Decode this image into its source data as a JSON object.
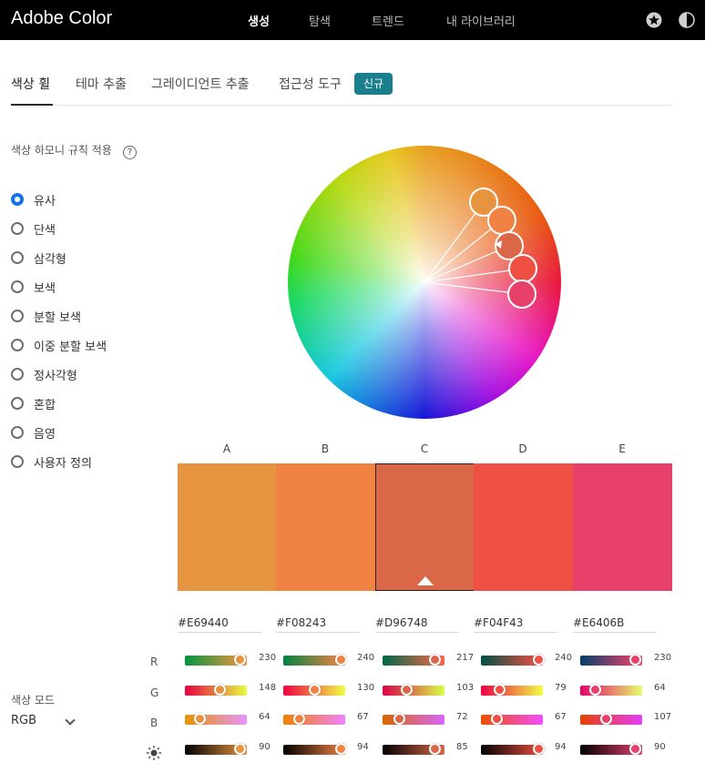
{
  "brand": "Adobe Color",
  "nav": [
    "생성",
    "탐색",
    "트렌드",
    "내 라이브러리"
  ],
  "tabs": [
    "색상 휠",
    "테마 추출",
    "그레이디언트 추출",
    "접근성 도구"
  ],
  "badge": "신규",
  "harmony": {
    "title": "색상 하모니 규칙 적용",
    "help": "?",
    "options": [
      "유사",
      "단색",
      "삼각형",
      "보색",
      "분할 보색",
      "이중 분할 보색",
      "정사각형",
      "혼합",
      "음영",
      "사용자 정의"
    ],
    "selected": "유사"
  },
  "columns": [
    "A",
    "B",
    "C",
    "D",
    "E"
  ],
  "selected_column": "C",
  "swatches": [
    {
      "hex": "#E69440",
      "color": "#E69440",
      "r": 230,
      "g": 148,
      "b": 64,
      "bright": 90
    },
    {
      "hex": "#F08243",
      "color": "#F08243",
      "r": 240,
      "g": 130,
      "b": 67,
      "bright": 94
    },
    {
      "hex": "#D96748",
      "color": "#D96748",
      "r": 217,
      "g": 103,
      "b": 72,
      "bright": 85
    },
    {
      "hex": "#F04F43",
      "color": "#F04F43",
      "r": 240,
      "g": 79,
      "b": 67,
      "bright": 94
    },
    {
      "hex": "#E6406B",
      "color": "#E6406B",
      "r": 230,
      "g": 64,
      "b": 107,
      "bright": 90
    }
  ],
  "channels": [
    "R",
    "G",
    "B"
  ],
  "brightness_icon": "sun-icon",
  "color_mode": {
    "label": "색상 모드",
    "value": "RGB"
  },
  "icons": {
    "favorites": "star-icon",
    "theme": "contrast-icon",
    "mode_dropdown": "chevron-down-icon"
  }
}
